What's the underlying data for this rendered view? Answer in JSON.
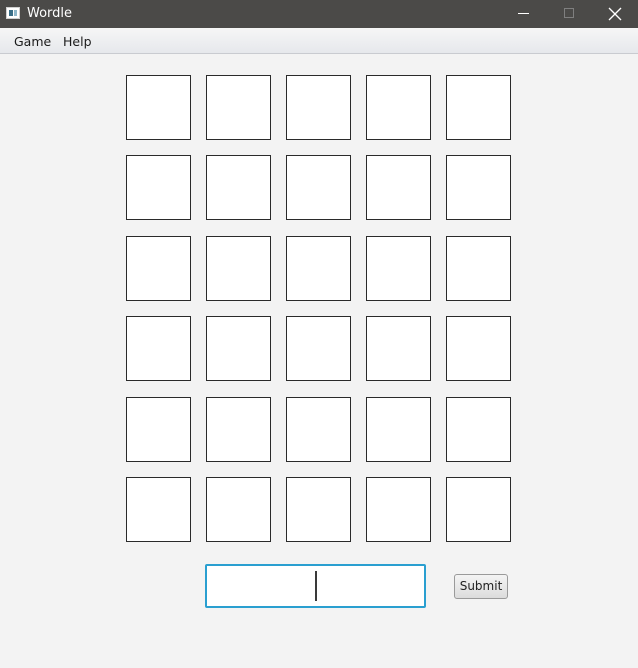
{
  "window": {
    "title": "Wordle",
    "titlebar_color": "#4b4a48"
  },
  "menu": {
    "items": [
      {
        "label": "Game"
      },
      {
        "label": "Help"
      }
    ]
  },
  "board": {
    "rows": 6,
    "columns": 5,
    "letters": [
      [
        "",
        "",
        "",
        "",
        ""
      ],
      [
        "",
        "",
        "",
        "",
        ""
      ],
      [
        "",
        "",
        "",
        "",
        ""
      ],
      [
        "",
        "",
        "",
        "",
        ""
      ],
      [
        "",
        "",
        "",
        "",
        ""
      ],
      [
        "",
        "",
        "",
        "",
        ""
      ]
    ]
  },
  "input": {
    "value": "",
    "focus_color": "#2a9fd0"
  },
  "submit": {
    "label": "Submit"
  }
}
